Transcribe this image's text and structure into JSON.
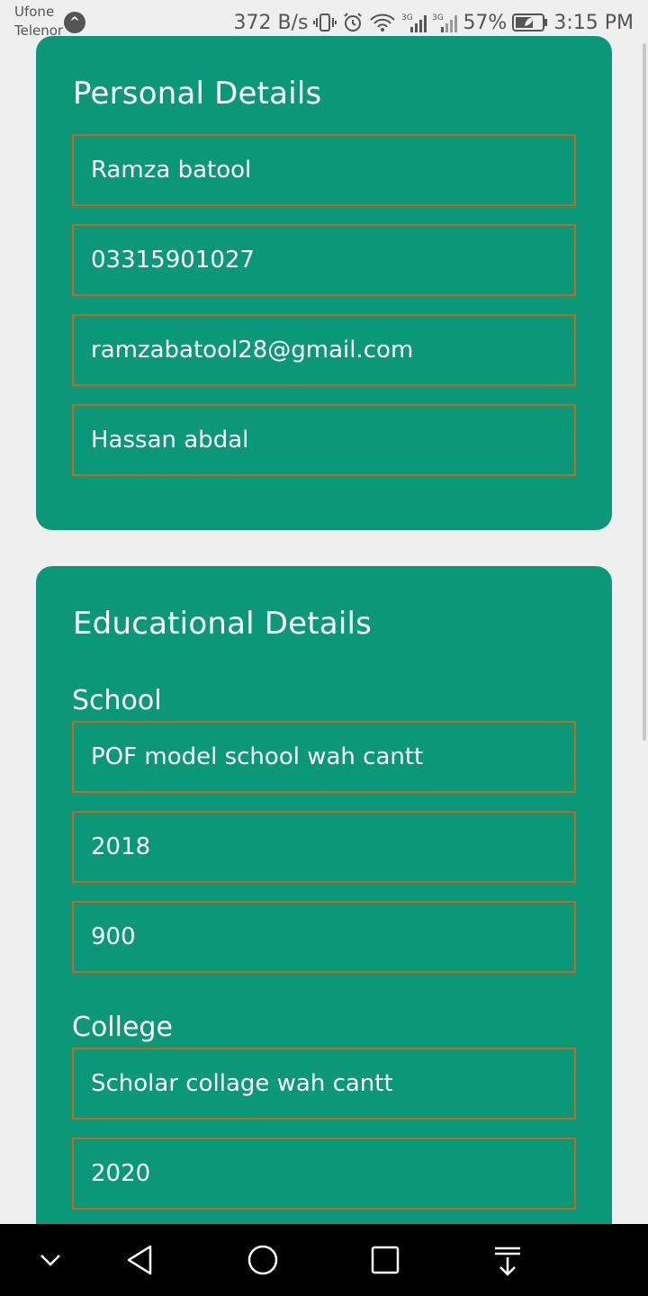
{
  "status_bar": {
    "carrier_1": "Ufone",
    "carrier_2": "Telenor",
    "net_speed": "372 B/s",
    "battery_percent": "57%",
    "time": "3:15 PM",
    "icons": [
      "vibrate-icon",
      "alarm-icon",
      "wifi-icon",
      "signal-3g-icon",
      "signal-3g-icon",
      "battery-saver-icon"
    ]
  },
  "personal": {
    "title": "Personal Details",
    "fields": [
      "Ramza batool",
      "03315901027",
      "ramzabatool28@gmail.com",
      "Hassan abdal"
    ]
  },
  "education": {
    "title": "Educational Details",
    "school": {
      "label": "School",
      "fields": [
        "POF model school wah cantt",
        "2018",
        "900"
      ]
    },
    "college": {
      "label": "College",
      "fields": [
        "Scholar collage wah cantt",
        "2020"
      ]
    }
  },
  "colors": {
    "card": "#0a9878",
    "field_border": "#c8661e",
    "background": "#efefef"
  },
  "nav_bar": {
    "icons": [
      "collapse-icon",
      "back-icon",
      "home-icon",
      "recents-icon",
      "notification-pulldown-icon"
    ]
  }
}
